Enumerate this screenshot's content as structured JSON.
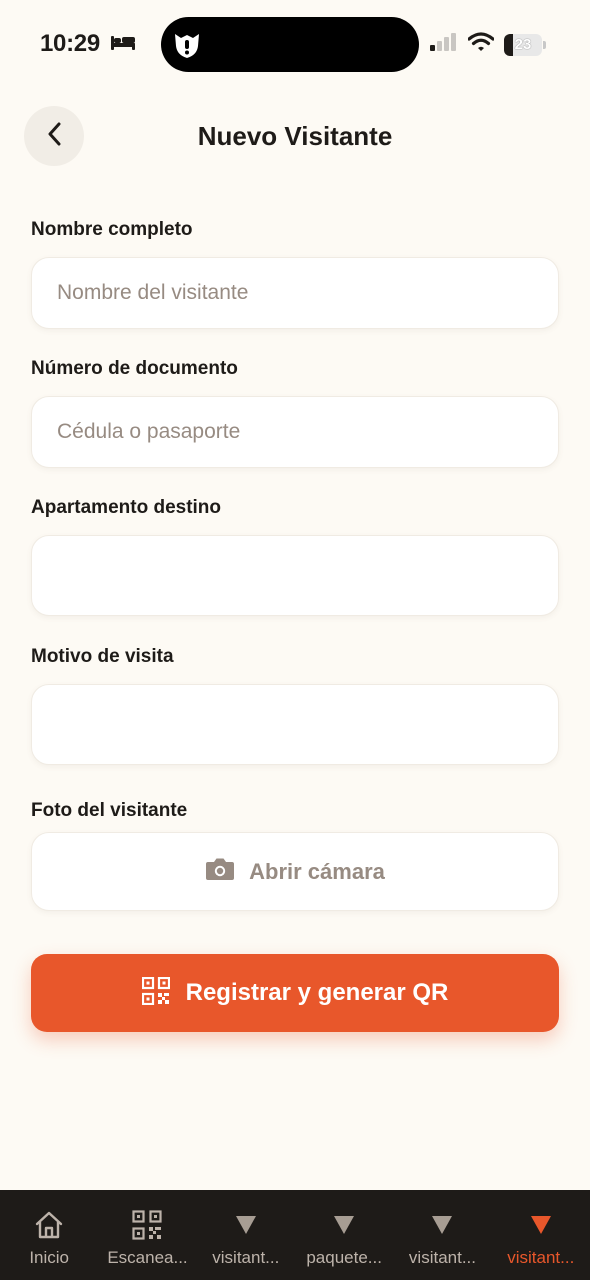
{
  "status_bar": {
    "time": "10:29",
    "battery_level": "23",
    "battery_fraction": 0.23,
    "icons": [
      "bed-icon",
      "app-mascot-icon",
      "signal-icon",
      "wifi-icon",
      "battery-icon"
    ]
  },
  "header": {
    "title": "Nuevo Visitante",
    "back_icon": "chevron-left-icon"
  },
  "form": {
    "name": {
      "label": "Nombre completo",
      "placeholder": "Nombre del visitante",
      "value": ""
    },
    "document": {
      "label": "Número de documento",
      "placeholder": "Cédula o pasaporte",
      "value": ""
    },
    "apartment": {
      "label": "Apartamento destino",
      "placeholder": "",
      "value": ""
    },
    "reason": {
      "label": "Motivo de visita",
      "placeholder": "",
      "value": ""
    },
    "photo": {
      "label": "Foto del visitante",
      "button_label": "Abrir cámara",
      "icon": "camera-icon"
    }
  },
  "submit": {
    "label": "Registrar y generar QR",
    "icon": "qr-code-icon"
  },
  "tabs": [
    {
      "label": "Inicio",
      "icon": "home-icon",
      "active": false
    },
    {
      "label": "Escanea...",
      "icon": "qr-scan-icon",
      "active": false
    },
    {
      "label": "visitant...",
      "icon": "triangle-down-icon",
      "active": false
    },
    {
      "label": "paquete...",
      "icon": "triangle-down-icon",
      "active": false
    },
    {
      "label": "visitant...",
      "icon": "triangle-down-icon",
      "active": false
    },
    {
      "label": "visitant...",
      "icon": "triangle-down-icon",
      "active": true
    }
  ],
  "colors": {
    "background": "#fdfaf4",
    "accent": "#e8572b",
    "tab_bar": "#1e1b18",
    "placeholder": "#978b82"
  }
}
